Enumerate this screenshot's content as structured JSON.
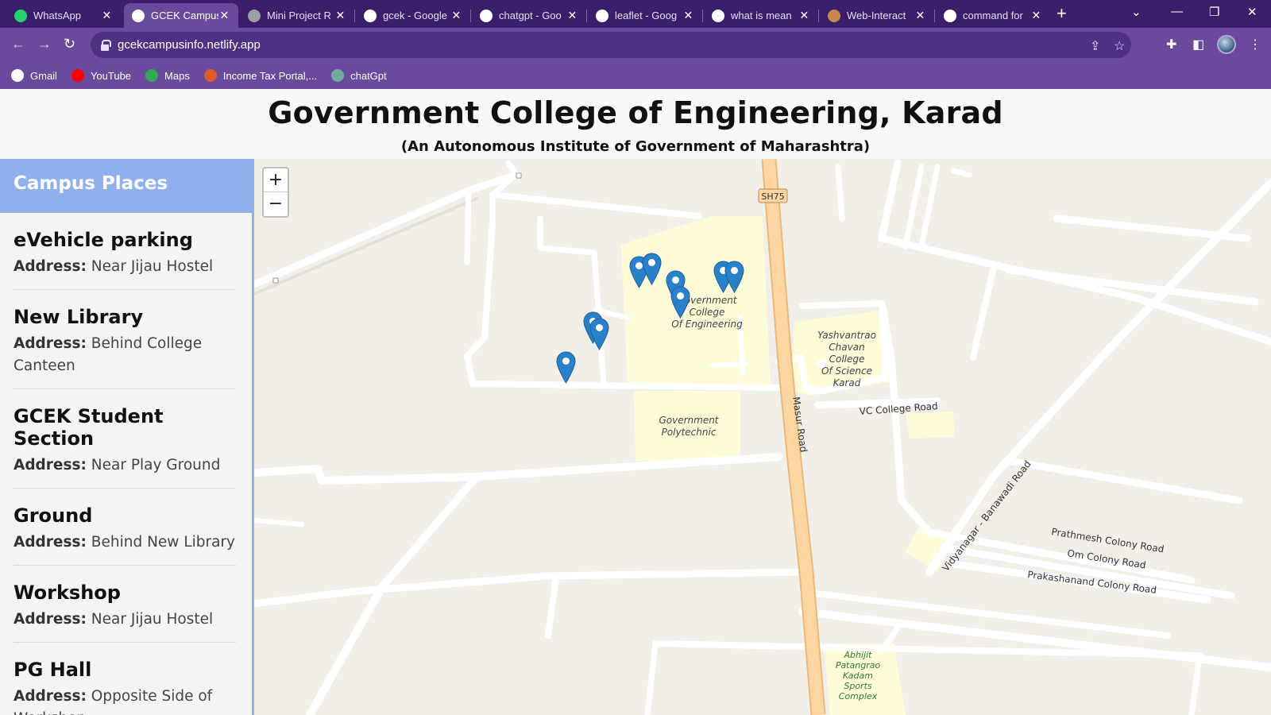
{
  "browser": {
    "tabs": [
      {
        "label": "WhatsApp",
        "icon": "whatsapp-icon",
        "color": "#25d366",
        "active": false
      },
      {
        "label": "GCEK Campus",
        "icon": "site-icon",
        "color": "#ffffff",
        "active": true
      },
      {
        "label": "Mini Project R",
        "icon": "globe-icon",
        "color": "#9aa0a6",
        "active": false
      },
      {
        "label": "gcek - Google",
        "icon": "google-icon",
        "color": "#ffffff",
        "active": false
      },
      {
        "label": "chatgpt - Goo",
        "icon": "google-icon",
        "color": "#ffffff",
        "active": false
      },
      {
        "label": "leaflet - Goog",
        "icon": "google-icon",
        "color": "#ffffff",
        "active": false
      },
      {
        "label": "what is mean",
        "icon": "google-icon",
        "color": "#ffffff",
        "active": false
      },
      {
        "label": "Web-Interact",
        "icon": "web-icon",
        "color": "#c8884a",
        "active": false
      },
      {
        "label": "command for",
        "icon": "google-icon",
        "color": "#ffffff",
        "active": false
      }
    ],
    "new_tab": "+",
    "close_glyph": "✕",
    "url": "gcekcampusinfo.netlify.app",
    "bookmarks": [
      {
        "label": "Gmail",
        "icon": "google-icon",
        "color": "#ffffff"
      },
      {
        "label": "YouTube",
        "icon": "youtube-icon",
        "color": "#ff0000"
      },
      {
        "label": "Maps",
        "icon": "maps-icon",
        "color": "#34a853"
      },
      {
        "label": "Income Tax Portal,...",
        "icon": "income-tax-icon",
        "color": "#e05a2b"
      },
      {
        "label": "chatGpt",
        "icon": "chatgpt-icon",
        "color": "#74aa9c"
      }
    ]
  },
  "page": {
    "title": "Government College of Engineering, Karad",
    "subtitle": "(An Autonomous Institute of Government of Maharashtra)"
  },
  "sidebar": {
    "heading": "Campus Places",
    "address_label": "Address:",
    "places": [
      {
        "name": "eVehicle parking",
        "address": "Near Jijau Hostel"
      },
      {
        "name": "New Library",
        "address": "Behind College Canteen"
      },
      {
        "name": "GCEK Student Section",
        "address": "Near Play Ground"
      },
      {
        "name": "Ground",
        "address": "Behind New Library"
      },
      {
        "name": "Workshop",
        "address": "Near Jijau Hostel"
      },
      {
        "name": "PG Hall",
        "address": "Opposite Side of Workshop"
      }
    ]
  },
  "map": {
    "zoom_in": "+",
    "zoom_out": "−",
    "labels": {
      "sh75": "SH75",
      "gce_1": "Government",
      "gce_2": "College",
      "gce_3": "Of Engineering",
      "ycc_1": "Yashvantrao",
      "ycc_2": "Chavan",
      "ycc_3": "College",
      "ycc_4": "Of Science",
      "ycc_5": "Karad",
      "poly_1": "Government",
      "poly_2": "Polytechnic",
      "vc_road": "VC College Road",
      "masur_road": "Masur Road",
      "vidyanagar_road": "Vidyanagar - Banawadi Road",
      "prathmesh": "Prathmesh Colony Road",
      "om": "Om Colony Road",
      "prakashanand": "Prakashanand Colony Road",
      "sports_1": "Abhijit",
      "sports_2": "Patangrao",
      "sports_3": "Kadam",
      "sports_4": "Sports",
      "sports_5": "Complex"
    },
    "marker_color": "#2a81cb",
    "land_color": "#f2efe9",
    "campus_color": "#fdfbd8",
    "highway_color": "#fcd5a0"
  }
}
